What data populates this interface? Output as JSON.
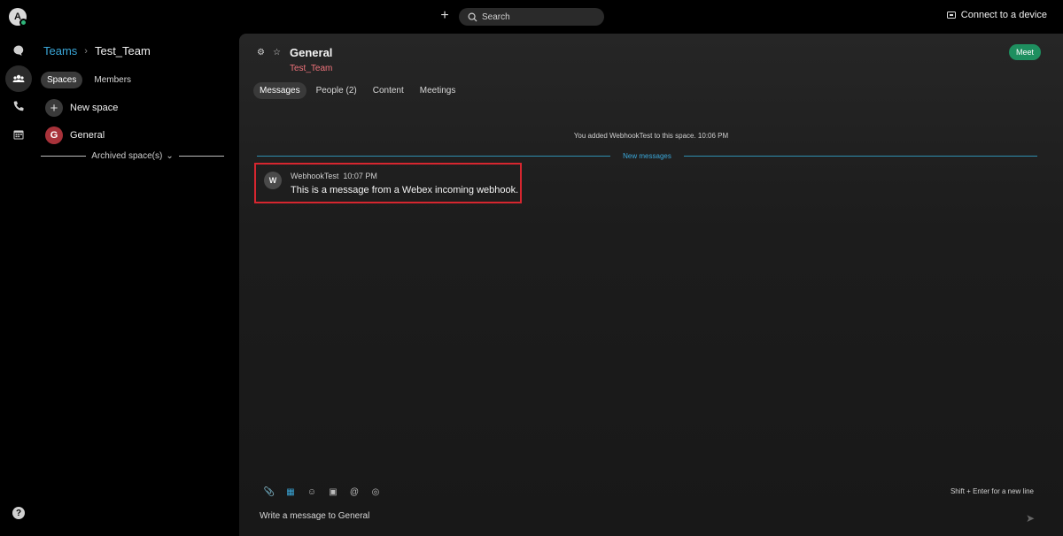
{
  "topbar": {
    "avatar_initial": "A",
    "search_placeholder": "Search",
    "connect_label": "Connect to a device"
  },
  "rail": {
    "items": [
      "messaging-icon",
      "teams-icon",
      "calls-icon",
      "calendar-icon"
    ],
    "active": "teams-icon",
    "help_label": "?"
  },
  "teams_panel": {
    "breadcrumb_root": "Teams",
    "breadcrumb_sep": "›",
    "team_name": "Test_Team",
    "tabs": [
      "Spaces",
      "Members"
    ],
    "selected_tab": "Spaces",
    "new_space_label": "New space",
    "spaces": [
      {
        "initial": "G",
        "name": "General"
      }
    ],
    "archived_label": "Archived space(s)"
  },
  "space": {
    "title": "General",
    "team": "Test_Team",
    "meet_label": "Meet",
    "tabs": [
      "Messages",
      "People (2)",
      "Content",
      "Meetings"
    ],
    "selected_tab": "Messages",
    "system_message": "You added WebhookTest to this space. 10:06 PM",
    "new_messages_label": "New messages",
    "message": {
      "avatar_initial": "W",
      "sender": "WebhookTest",
      "time": "10:07 PM",
      "text": "This is a message from a Webex incoming webhook."
    },
    "composer": {
      "hint": "Shift + Enter for a new line",
      "placeholder": "Write a message to General"
    }
  },
  "colors": {
    "accent_blue": "#3aa7d9",
    "team_red": "#f0737b",
    "meet_green": "#1e8f5f",
    "highlight_red": "#d6262f"
  }
}
